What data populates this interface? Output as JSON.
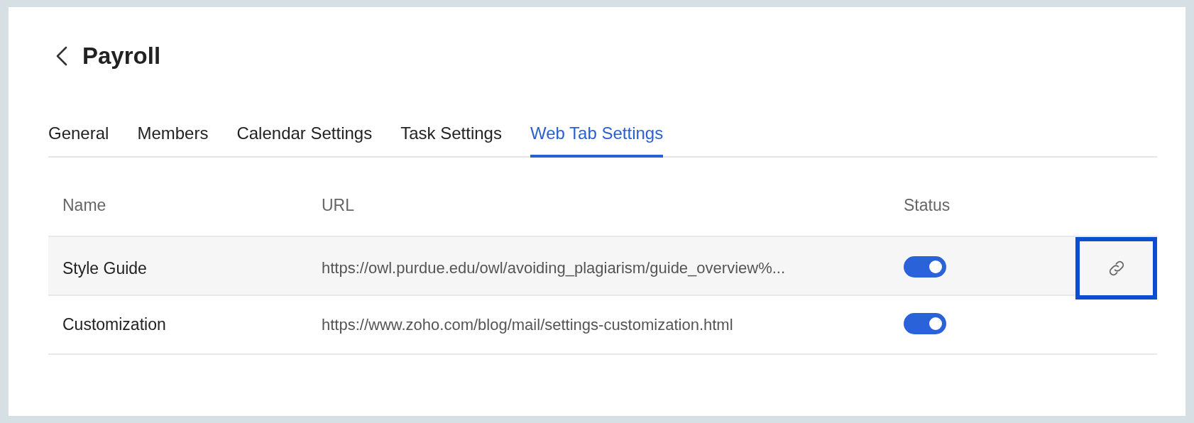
{
  "header": {
    "title": "Payroll"
  },
  "tabs": [
    {
      "label": "General",
      "selected": false
    },
    {
      "label": "Members",
      "selected": false
    },
    {
      "label": "Calendar Settings",
      "selected": false
    },
    {
      "label": "Task Settings",
      "selected": false
    },
    {
      "label": "Web Tab Settings",
      "selected": true
    }
  ],
  "table": {
    "columns": [
      "Name",
      "URL",
      "Status"
    ],
    "rows": [
      {
        "name": "Style Guide",
        "url": "https://owl.purdue.edu/owl/avoiding_plagiarism/guide_overview%...",
        "on": true,
        "hovered": true
      },
      {
        "name": "Customization",
        "url": "https://www.zoho.com/blog/mail/settings-customization.html",
        "on": true,
        "hovered": false
      }
    ]
  }
}
